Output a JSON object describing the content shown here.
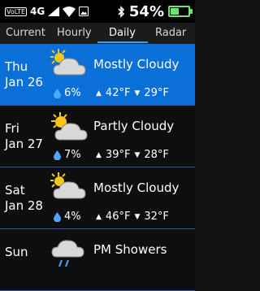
{
  "status_bar": {
    "volte": "VoLTE",
    "network": "4G",
    "battery_percent": "54%",
    "battery_level": 0.54,
    "icons": [
      "volte-icon",
      "signal-icon",
      "wifi-icon",
      "image-notification-icon",
      "bluetooth-icon",
      "battery-icon"
    ]
  },
  "tabs": [
    {
      "label": "Current"
    },
    {
      "label": "Hourly"
    },
    {
      "label": "Daily",
      "active": true
    },
    {
      "label": "Radar"
    }
  ],
  "days": [
    {
      "day": "Thu",
      "date": "Jan 26",
      "condition": "Mostly Cloudy",
      "precip": "6%",
      "high": "42°F",
      "low": "29°F",
      "icon": "mostly-cloudy-icon",
      "selected": true
    },
    {
      "day": "Fri",
      "date": "Jan 27",
      "condition": "Partly Cloudy",
      "precip": "7%",
      "high": "39°F",
      "low": "28°F",
      "icon": "partly-cloudy-icon"
    },
    {
      "day": "Sat",
      "date": "Jan 28",
      "condition": "Mostly Cloudy",
      "precip": "4%",
      "high": "46°F",
      "low": "32°F",
      "icon": "mostly-cloudy-icon"
    },
    {
      "day": "Sun",
      "condition": "PM Showers",
      "icon": "showers-icon"
    }
  ],
  "colors": {
    "accent": "#3aa0ff",
    "selected_row": "#0a6fd6",
    "battery": "#6fe36f",
    "rain_drop": "#4aa8ff"
  }
}
